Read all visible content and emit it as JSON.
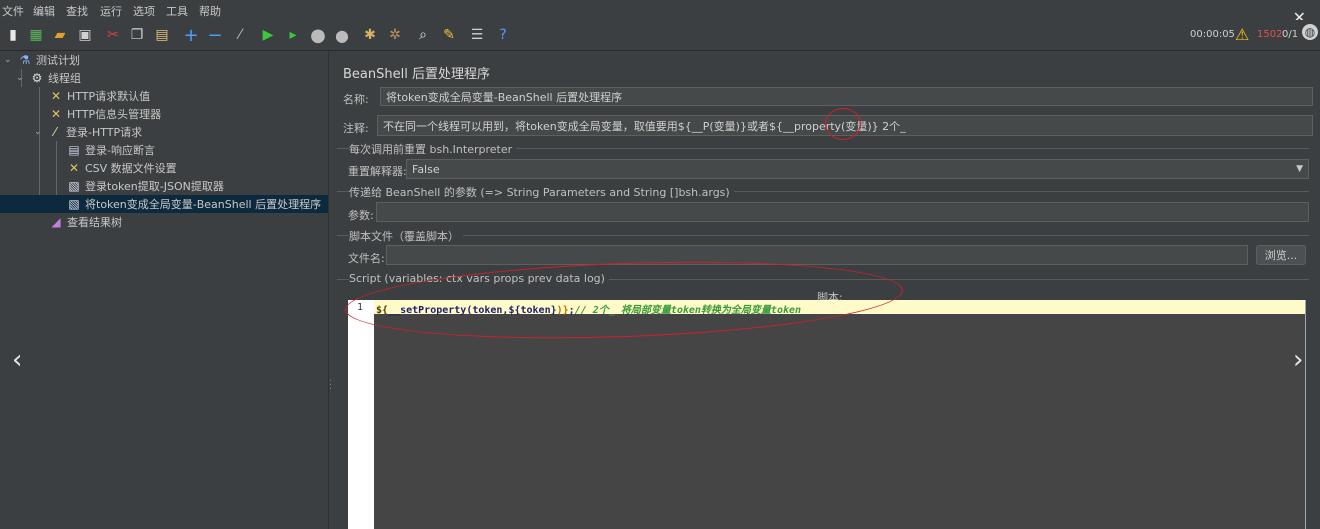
{
  "menu": [
    "文件",
    "编辑",
    "查找",
    "运行",
    "选项",
    "工具",
    "帮助"
  ],
  "status": {
    "elapsed": "00:00:05",
    "error_count": "1502",
    "threads": "0/1"
  },
  "tree": {
    "items": [
      {
        "label": "测试计划"
      },
      {
        "label": "线程组"
      },
      {
        "label": "HTTP请求默认值"
      },
      {
        "label": "HTTP信息头管理器"
      },
      {
        "label": "登录-HTTP请求"
      },
      {
        "label": "登录-响应断言"
      },
      {
        "label": "CSV 数据文件设置"
      },
      {
        "label": "登录token提取-JSON提取器"
      },
      {
        "label": "将token变成全局变量-BeanShell 后置处理程序"
      },
      {
        "label": "查看结果树"
      }
    ]
  },
  "panel": {
    "title": "BeanShell 后置处理程序",
    "name_label": "名称:",
    "name_value": "将token变成全局变量-BeanShell 后置处理程序",
    "comment_label": "注释:",
    "comment_value": "不在同一个线程可以用到，将token变成全局变量，取值要用${__P(变量)}或者${__property(变量)}  2个_",
    "reset_group": "每次调用前重置 bsh.Interpreter",
    "reset_label": "重置解释器:",
    "reset_value": "False",
    "params_group": "传递给 BeanShell 的参数 (=> String Parameters and String []bsh.args)",
    "params_label": "参数:",
    "params_value": "",
    "script_file_group": "脚本文件（覆盖脚本）",
    "file_label": "文件名:",
    "file_value": "",
    "browse_label": "浏览...",
    "script_group": "Script (variables: ctx vars props prev data log)",
    "script_label": "脚本:",
    "line_number": "1",
    "code": {
      "dollar": "${",
      "fn": "__setProperty(token,${token}",
      "close": ")}",
      "semi": ";",
      "comment": "// 2个_ 将局部变量token转换为全局变量token"
    }
  },
  "colors": {
    "background": "#3c3f41",
    "annotation": "#d0202a",
    "code_highlight": "#fffbc8",
    "selection": "#0d293e"
  }
}
